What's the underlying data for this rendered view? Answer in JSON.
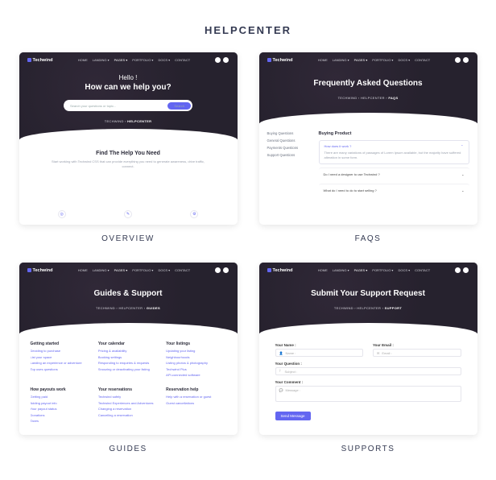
{
  "page_title": "HELPCENTER",
  "brand": "Techwind",
  "nav": [
    "HOME",
    "LANDING ▾",
    "PAGES ▾",
    "PORTFOLIO ▾",
    "DOCS ▾",
    "CONTACT"
  ],
  "cards": {
    "overview": {
      "hello": "Hello !",
      "title": "How can we help you?",
      "search_placeholder": "Search your questions or topic...",
      "search_btn": "Search",
      "crumb_pre": "TECHWIND  ›  ",
      "crumb_cur": "HELPCENTER",
      "section_title": "Find The Help You Need",
      "section_sub": "Start working with Techwind CSS that can provide everything you need to generate awareness, drive traffic, connect.",
      "caption": "OVERVIEW"
    },
    "faqs": {
      "title": "Frequently Asked Questions",
      "crumb_pre": "TECHWIND  ›  HELPCENTER  ›  ",
      "crumb_cur": "FAQS",
      "categories": [
        "Buying Questions",
        "General Questions",
        "Payments Questions",
        "Support Questions"
      ],
      "section": "Buying Product",
      "q1": "How does it work ?",
      "a1": "There are many variations of passages of Lorem Ipsum available, but the majority have suffered alteration in some form.",
      "q2": "Do I need a designer to use Techwind ?",
      "q3": "What do I need to do to start selling ?",
      "caption": "FAQS"
    },
    "guides": {
      "title": "Guides & Support",
      "crumb_pre": "TECHWIND  ›  HELPCENTER  ›  ",
      "crumb_cur": "GUIDES",
      "cols_a": [
        {
          "h": "Getting started",
          "items": [
            "Deciding to purchase",
            "List your space",
            "Landing an experience or adventure",
            "Top uses questions"
          ]
        },
        {
          "h": "Your calendar",
          "items": [
            "Pricing & availability",
            "Booking settings",
            "Responding to enquiries & requests",
            "Snoozing or deactivating your listing"
          ]
        },
        {
          "h": "Your listings",
          "items": [
            "Updating your listing",
            "Neighbourhoods",
            "Listing photos & photography",
            "Techwind Plus",
            "API-connected software"
          ]
        }
      ],
      "cols_b": [
        {
          "h": "How payouts work",
          "items": [
            "Getting paid",
            "Adding payout info",
            "Your payout status",
            "Donations",
            "Taxes"
          ]
        },
        {
          "h": "Your reservations",
          "items": [
            "Techwind safely",
            "Techwind Experiences and Adventures",
            "Changing a reservation",
            "Cancelling a reservation"
          ]
        },
        {
          "h": "Reservation help",
          "items": [
            "Help with a reservation or guest",
            "Guest cancellations"
          ]
        }
      ],
      "caption": "GUIDES"
    },
    "supports": {
      "title": "Submit Your Support Request",
      "crumb_pre": "TECHWIND  ›  HELPCENTER  ›  ",
      "crumb_cur": "SUPPORT",
      "name_label": "Your Name :",
      "email_label": "Your Email :",
      "question_label": "Your Question :",
      "comment_label": "Your Comment :",
      "name_ph": "Name :",
      "email_ph": "Email :",
      "subject_ph": "Subject :",
      "msg_ph": "Message :",
      "send": "Send Message",
      "caption": "SUPPORTS"
    }
  }
}
